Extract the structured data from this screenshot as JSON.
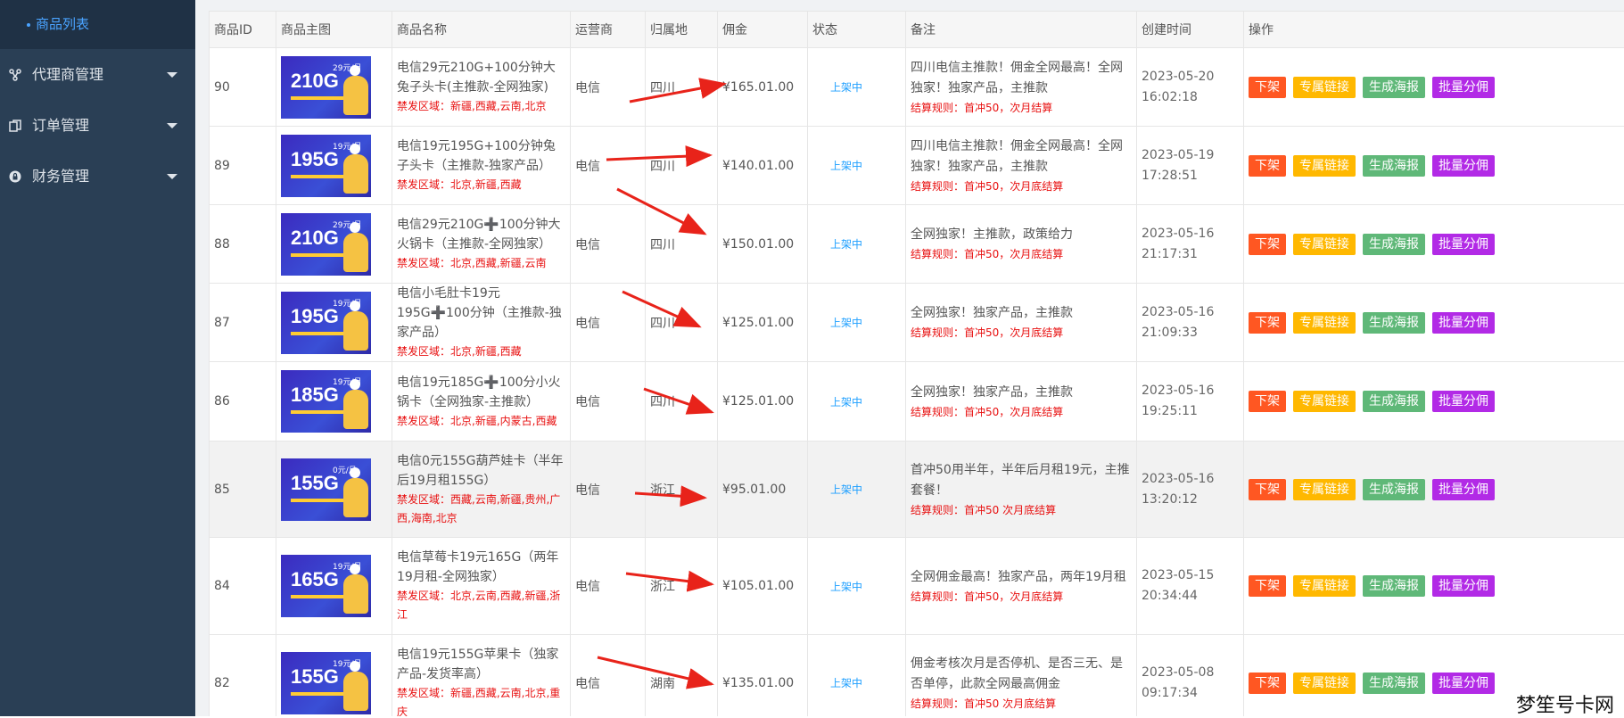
{
  "sidebar": {
    "active_item": "商品列表",
    "items": [
      {
        "label": "代理商管理"
      },
      {
        "label": "订单管理"
      },
      {
        "label": "财务管理"
      }
    ]
  },
  "table": {
    "headers": {
      "id": "商品ID",
      "image": "商品主图",
      "name": "商品名称",
      "carrier": "运营商",
      "region": "归属地",
      "commission": "佣金",
      "status": "状态",
      "note": "备注",
      "created": "创建时间",
      "actions": "操作"
    },
    "action_labels": {
      "off": "下架",
      "link": "专属链接",
      "poster": "生成海报",
      "batch": "批量分佣"
    },
    "rows": [
      {
        "id": "90",
        "img_gb": "210G",
        "img_price": "29元/月",
        "name": "电信29元210G+100分钟大兔子头卡(主推款-全网独家)",
        "banned": "禁发区域：新疆,西藏,云南,北京",
        "carrier": "电信",
        "region": "四川",
        "commission": "¥165.01.00",
        "status": "上架中",
        "note": "四川电信主推款！佣金全网最高！全网独家！独家产品，主推款",
        "rule": "结算规则：首冲50，次月结算",
        "created": "2023-05-20 16:02:18"
      },
      {
        "id": "89",
        "img_gb": "195G",
        "img_price": "19元/月",
        "name": "电信19元195G+100分钟兔子头卡（主推款-独家产品）",
        "banned": "禁发区域：北京,新疆,西藏",
        "carrier": "电信",
        "region": "四川",
        "commission": "¥140.01.00",
        "status": "上架中",
        "note": "四川电信主推款！佣金全网最高！全网独家！独家产品，主推款",
        "rule": "结算规则：首冲50，次月底结算",
        "created": "2023-05-19 17:28:51"
      },
      {
        "id": "88",
        "img_gb": "210G",
        "img_price": "29元/月",
        "name": "电信29元210G➕100分钟大火锅卡（主推款-全网独家）",
        "banned": "禁发区域：北京,西藏,新疆,云南",
        "carrier": "电信",
        "region": "四川",
        "commission": "¥150.01.00",
        "status": "上架中",
        "note": "全网独家！主推款，政策给力",
        "rule": "结算规则：首冲50，次月底结算",
        "created": "2023-05-16 21:17:31"
      },
      {
        "id": "87",
        "img_gb": "195G",
        "img_price": "19元/月",
        "name": "电信小毛肚卡19元195G➕100分钟（主推款-独家产品）",
        "banned": "禁发区域：北京,新疆,西藏",
        "carrier": "电信",
        "region": "四川",
        "commission": "¥125.01.00",
        "status": "上架中",
        "note": "全网独家！独家产品，主推款",
        "rule": "结算规则：首冲50，次月底结算",
        "created": "2023-05-16 21:09:33"
      },
      {
        "id": "86",
        "img_gb": "185G",
        "img_price": "19元/月",
        "name": "电信19元185G➕100分小火锅卡（全网独家-主推款）",
        "banned": "禁发区域：北京,新疆,内蒙古,西藏",
        "carrier": "电信",
        "region": "四川",
        "commission": "¥125.01.00",
        "status": "上架中",
        "note": "全网独家！独家产品，主推款",
        "rule": "结算规则：首冲50，次月底结算",
        "created": "2023-05-16 19:25:11"
      },
      {
        "id": "85",
        "img_gb": "155G",
        "img_price": "0元/月",
        "name": "电信0元155G葫芦娃卡（半年后19月租155G）",
        "banned": "禁发区域：西藏,云南,新疆,贵州,广西,海南,北京",
        "carrier": "电信",
        "region": "浙江",
        "commission": "¥95.01.00",
        "status": "上架中",
        "note": "首冲50用半年，半年后月租19元，主推套餐！",
        "rule": "结算规则：首冲50 次月底结算",
        "created": "2023-05-16 13:20:12"
      },
      {
        "id": "84",
        "img_gb": "165G",
        "img_price": "19元/月",
        "name": "电信草莓卡19元165G（两年19月租-全网独家）",
        "banned": "禁发区域：北京,云南,西藏,新疆,浙江",
        "carrier": "电信",
        "region": "浙江",
        "commission": "¥105.01.00",
        "status": "上架中",
        "note": "全网佣金最高！独家产品，两年19月租",
        "rule": "结算规则：首冲50，次月底结算",
        "created": "2023-05-15 20:34:44"
      },
      {
        "id": "82",
        "img_gb": "155G",
        "img_price": "19元/月",
        "name": "电信19元155G苹果卡（独家产品-发货率高）",
        "banned": "禁发区域：新疆,西藏,云南,北京,重庆",
        "carrier": "电信",
        "region": "湖南",
        "commission": "¥135.01.00",
        "status": "上架中",
        "note": "佣金考核次月是否停机、是否三无、是否单停，此款全网最高佣金",
        "rule": "结算规则：首冲50 次月底结算",
        "created": "2023-05-08 09:17:34"
      }
    ]
  },
  "watermark": "梦笙号卡网",
  "colors": {
    "sidebar": "#2a3f55",
    "active": "#4aa3ff",
    "off": "#ff5722",
    "link": "#ffb800",
    "poster": "#5fb878",
    "batch": "#b22ae6",
    "arrow": "#e8231a"
  }
}
